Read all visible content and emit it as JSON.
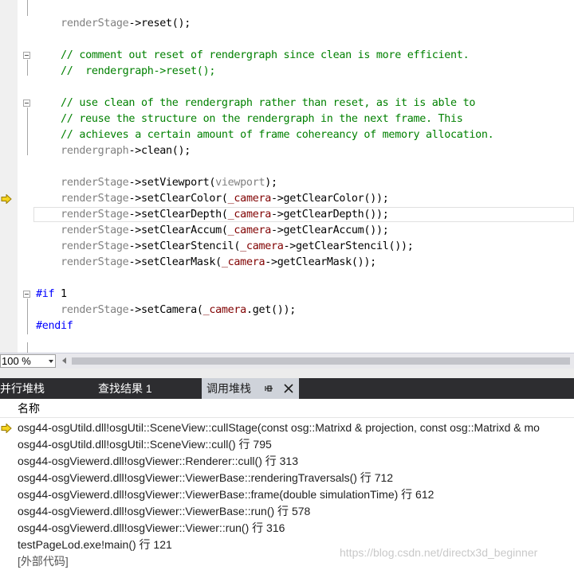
{
  "editor": {
    "lines": [
      [
        {
          "t": "    "
        },
        {
          "t": "renderStage",
          "c": "gray"
        },
        {
          "t": "->reset();"
        }
      ],
      [],
      [
        {
          "t": "    // comment out reset of rendergraph since clean is more efficient.",
          "c": "green"
        }
      ],
      [
        {
          "t": "    //  rendergraph->reset();",
          "c": "green"
        }
      ],
      [],
      [
        {
          "t": "    // use clean of the rendergraph rather than reset, as it is able to",
          "c": "green"
        }
      ],
      [
        {
          "t": "    // reuse the structure on the rendergraph in the next frame. This",
          "c": "green"
        }
      ],
      [
        {
          "t": "    // achieves a certain amount of frame cohereancy of memory allocation.",
          "c": "green"
        }
      ],
      [
        {
          "t": "    "
        },
        {
          "t": "rendergraph",
          "c": "gray"
        },
        {
          "t": "->clean();"
        }
      ],
      [],
      [
        {
          "t": "    "
        },
        {
          "t": "renderStage",
          "c": "gray"
        },
        {
          "t": "->setViewport("
        },
        {
          "t": "viewport",
          "c": "gray"
        },
        {
          "t": ");"
        }
      ],
      [
        {
          "t": "    "
        },
        {
          "t": "renderStage",
          "c": "gray"
        },
        {
          "t": "->setClearColor("
        },
        {
          "t": "_camera",
          "c": "maroon"
        },
        {
          "t": "->getClearColor());"
        }
      ],
      [
        {
          "t": "    "
        },
        {
          "t": "renderStage",
          "c": "gray"
        },
        {
          "t": "->setClearDepth("
        },
        {
          "t": "_camera",
          "c": "maroon"
        },
        {
          "t": "->getClearDepth());"
        }
      ],
      [
        {
          "t": "    "
        },
        {
          "t": "renderStage",
          "c": "gray"
        },
        {
          "t": "->setClearAccum("
        },
        {
          "t": "_camera",
          "c": "maroon"
        },
        {
          "t": "->getClearAccum());"
        }
      ],
      [
        {
          "t": "    "
        },
        {
          "t": "renderStage",
          "c": "gray"
        },
        {
          "t": "->setClearStencil("
        },
        {
          "t": "_camera",
          "c": "maroon"
        },
        {
          "t": "->getClearStencil());"
        }
      ],
      [
        {
          "t": "    "
        },
        {
          "t": "renderStage",
          "c": "gray"
        },
        {
          "t": "->setClearMask("
        },
        {
          "t": "_camera",
          "c": "maroon"
        },
        {
          "t": "->getClearMask());"
        }
      ],
      [],
      [
        {
          "t": "#if",
          "c": "blue"
        },
        {
          "t": " 1"
        }
      ],
      [
        {
          "t": "    "
        },
        {
          "t": "renderStage",
          "c": "gray"
        },
        {
          "t": "->setCamera("
        },
        {
          "t": "_camera",
          "c": "maroon"
        },
        {
          "t": ".get());"
        }
      ],
      [
        {
          "t": "#endif",
          "c": "blue"
        }
      ]
    ]
  },
  "zoom": {
    "value": "100 %"
  },
  "tabs": [
    {
      "label": "并行堆栈",
      "active": false
    },
    {
      "label": "查找结果 1",
      "active": false
    },
    {
      "label": "调用堆栈",
      "active": true
    }
  ],
  "callstack": {
    "column_header": "名称",
    "rows": [
      "osg44-osgUtild.dll!osgUtil::SceneView::cullStage(const osg::Matrixd & projection, const osg::Matrixd & mo",
      "osg44-osgUtild.dll!osgUtil::SceneView::cull() 行 795",
      "osg44-osgViewerd.dll!osgViewer::Renderer::cull() 行 313",
      "osg44-osgViewerd.dll!osgViewer::ViewerBase::renderingTraversals() 行 712",
      "osg44-osgViewerd.dll!osgViewer::ViewerBase::frame(double simulationTime) 行 612",
      "osg44-osgViewerd.dll!osgViewer::ViewerBase::run() 行 578",
      "osg44-osgViewerd.dll!osgViewer::Viewer::run() 行 316",
      "testPageLod.exe!main() 行 121",
      "[外部代码]"
    ]
  },
  "watermark": "https://blog.csdn.net/directx3d_beginner",
  "colors": {
    "comment": "#008000",
    "preprocessor": "#0000ff",
    "member": "#800000",
    "variable": "#808080",
    "current_arrow": "#f5d41f",
    "tab_bar": "#2d2d30",
    "active_tab": "#cfd3da"
  }
}
